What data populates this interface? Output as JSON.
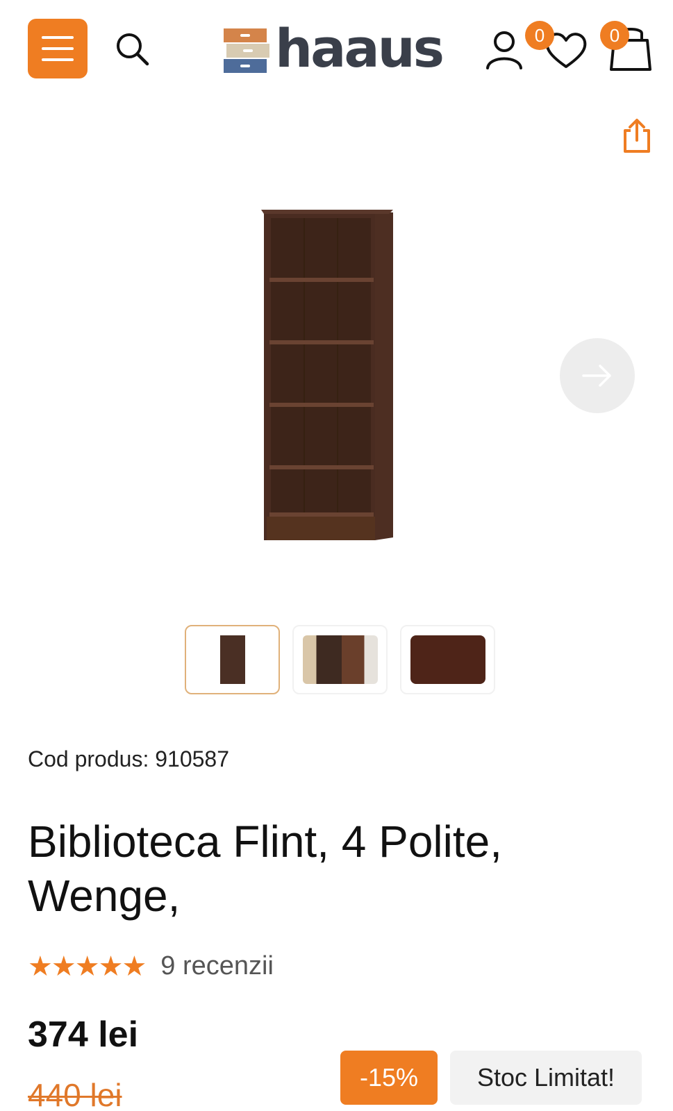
{
  "header": {
    "logo_text": "haaus",
    "wishlist_count": "0",
    "cart_count": "0",
    "icons": [
      "menu-icon",
      "search-icon",
      "user-icon",
      "heart-icon",
      "shopping-bag-icon",
      "share-icon",
      "arrow-right-icon"
    ]
  },
  "gallery": {
    "thumbnails": [
      "bookcase-front",
      "bookcase-room",
      "wenge-texture"
    ]
  },
  "product": {
    "code": "Cod produs: 910587",
    "title": "Biblioteca Flint, 4 Polite, Wenge,",
    "rating_stars": "★★★★★",
    "rating": 5,
    "reviews": "9 recenzii",
    "price": "374 lei",
    "old_price": "440 lei",
    "discount": "-15%",
    "stock": "Stoc Limitat!"
  },
  "colors": {
    "accent": "#ef7d22",
    "wood": "#4a2f24"
  }
}
